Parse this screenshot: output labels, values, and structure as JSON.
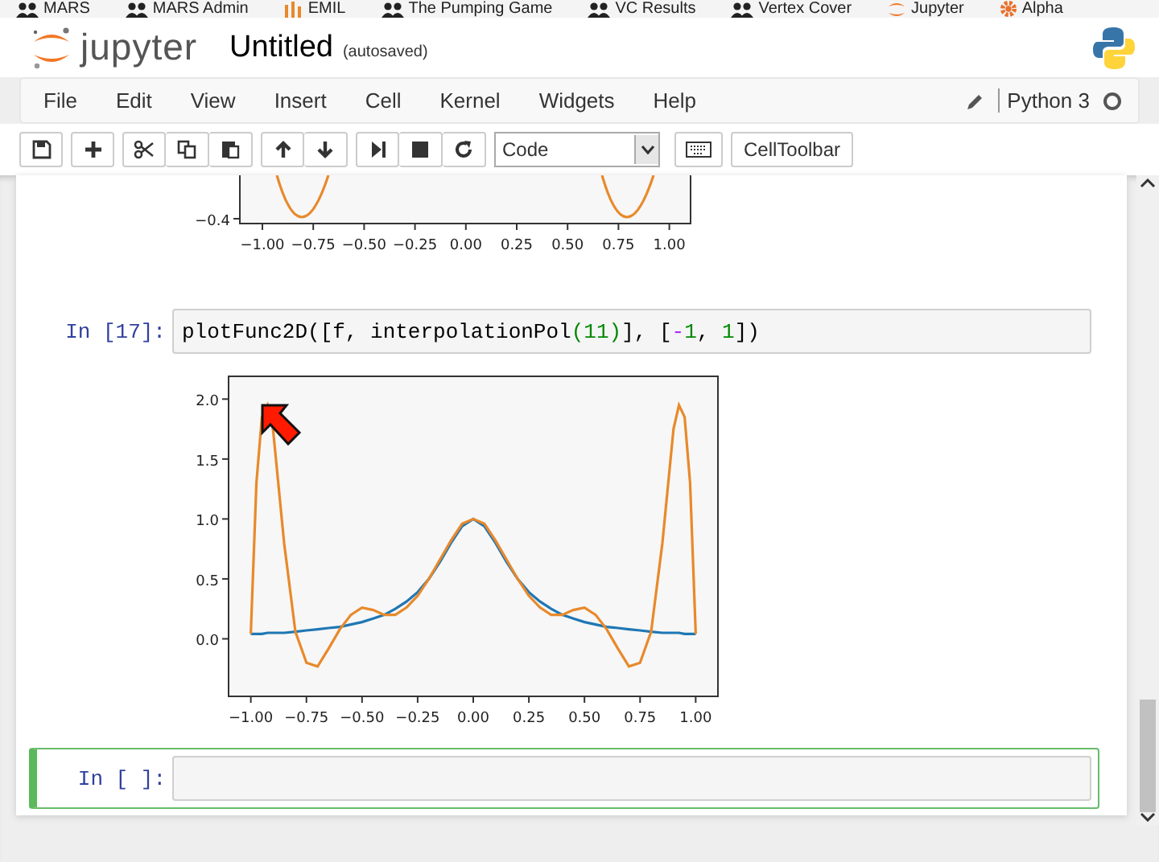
{
  "bookmarks": [
    {
      "label": "MARS",
      "kind": "people"
    },
    {
      "label": "MARS Admin",
      "kind": "people"
    },
    {
      "label": "EMIL",
      "kind": "bars"
    },
    {
      "label": "The Pumping Game",
      "kind": "people"
    },
    {
      "label": "VC Results",
      "kind": "people"
    },
    {
      "label": "Vertex Cover",
      "kind": "people"
    },
    {
      "label": "Jupyter",
      "kind": "jupyter"
    },
    {
      "label": "Alpha",
      "kind": "gear"
    }
  ],
  "header": {
    "logo_text": "jupyter",
    "title": "Untitled",
    "save_status": "(autosaved)"
  },
  "menu": [
    "File",
    "Edit",
    "View",
    "Insert",
    "Cell",
    "Kernel",
    "Widgets",
    "Help"
  ],
  "kernel": {
    "name": "Python 3",
    "idle": true
  },
  "toolbar": {
    "cell_type": "Code",
    "cell_toolbar": "CellToolbar"
  },
  "cells": [
    {
      "kind": "plot_fragment",
      "x_tick_labels": [
        "−1.00",
        "−0.75",
        "−0.50",
        "−0.25",
        "0.00",
        "0.25",
        "0.50",
        "0.75",
        "1.00"
      ],
      "y_tick_labels": [
        "−0.4"
      ]
    },
    {
      "kind": "input",
      "prompt": "In [17]:",
      "selected": false,
      "code": [
        {
          "text": "plotFunc2D([f, interpolationPol",
          "kind": "plain"
        },
        {
          "text": "(11)",
          "kind": "number"
        },
        {
          "text": "], [",
          "kind": "plain"
        },
        {
          "text": "-",
          "kind": "operator"
        },
        {
          "text": "1",
          "kind": "number"
        },
        {
          "text": ", ",
          "kind": "plain"
        },
        {
          "text": "1",
          "kind": "number"
        },
        {
          "text": "])",
          "kind": "plain"
        }
      ]
    },
    {
      "kind": "output",
      "chart_data": {
        "type": "line",
        "xlim": [
          -1.1,
          1.1
        ],
        "ylim": [
          -0.48,
          2.19
        ],
        "xticks": [
          {
            "value": -1,
            "label": "−1.00"
          },
          {
            "value": -0.75,
            "label": "−0.75"
          },
          {
            "value": -0.5,
            "label": "−0.50"
          },
          {
            "value": -0.25,
            "label": "−0.25"
          },
          {
            "value": 0,
            "label": "0.00"
          },
          {
            "value": 0.25,
            "label": "0.25"
          },
          {
            "value": 0.5,
            "label": "0.50"
          },
          {
            "value": 0.75,
            "label": "0.75"
          },
          {
            "value": 1,
            "label": "1.00"
          }
        ],
        "yticks": [
          {
            "value": 0,
            "label": "0.0"
          },
          {
            "value": 0.5,
            "label": "0.5"
          },
          {
            "value": 1,
            "label": "1.0"
          },
          {
            "value": 1.5,
            "label": "1.5"
          },
          {
            "value": 2,
            "label": "2.0"
          }
        ],
        "x": [
          -1,
          -0.975,
          -0.95,
          -0.925,
          -0.9,
          -0.85,
          -0.8,
          -0.75,
          -0.7,
          -0.65,
          -0.6,
          -0.55,
          -0.5,
          -0.45,
          -0.4,
          -0.35,
          -0.3,
          -0.25,
          -0.2,
          -0.15,
          -0.1,
          -0.05,
          0,
          0.05,
          0.1,
          0.15,
          0.2,
          0.25,
          0.3,
          0.35,
          0.4,
          0.45,
          0.5,
          0.55,
          0.6,
          0.65,
          0.7,
          0.75,
          0.8,
          0.85,
          0.9,
          0.925,
          0.95,
          0.975,
          1
        ],
        "series": [
          {
            "color": "#1f77b4",
            "values": [
              0.04,
              0.04,
              0.04,
              0.05,
              0.05,
              0.05,
              0.06,
              0.07,
              0.08,
              0.09,
              0.1,
              0.12,
              0.14,
              0.17,
              0.2,
              0.25,
              0.31,
              0.39,
              0.5,
              0.64,
              0.8,
              0.94,
              1,
              0.94,
              0.8,
              0.64,
              0.5,
              0.39,
              0.31,
              0.25,
              0.2,
              0.17,
              0.14,
              0.12,
              0.1,
              0.09,
              0.08,
              0.07,
              0.06,
              0.05,
              0.05,
              0.05,
              0.04,
              0.04,
              0.04
            ]
          },
          {
            "color": "#e8892b",
            "values": [
              0.04,
              1.3,
              1.85,
              1.95,
              1.75,
              0.8,
              0.06,
              -0.2,
              -0.23,
              -0.08,
              0.08,
              0.2,
              0.26,
              0.24,
              0.2,
              0.2,
              0.26,
              0.36,
              0.5,
              0.66,
              0.82,
              0.96,
              1,
              0.96,
              0.82,
              0.66,
              0.5,
              0.36,
              0.26,
              0.2,
              0.2,
              0.24,
              0.26,
              0.2,
              0.08,
              -0.08,
              -0.23,
              -0.2,
              0.06,
              0.8,
              1.75,
              1.95,
              1.85,
              1.3,
              0.04
            ]
          }
        ]
      }
    },
    {
      "kind": "input",
      "prompt": "In [ ]:",
      "selected": true
    }
  ]
}
